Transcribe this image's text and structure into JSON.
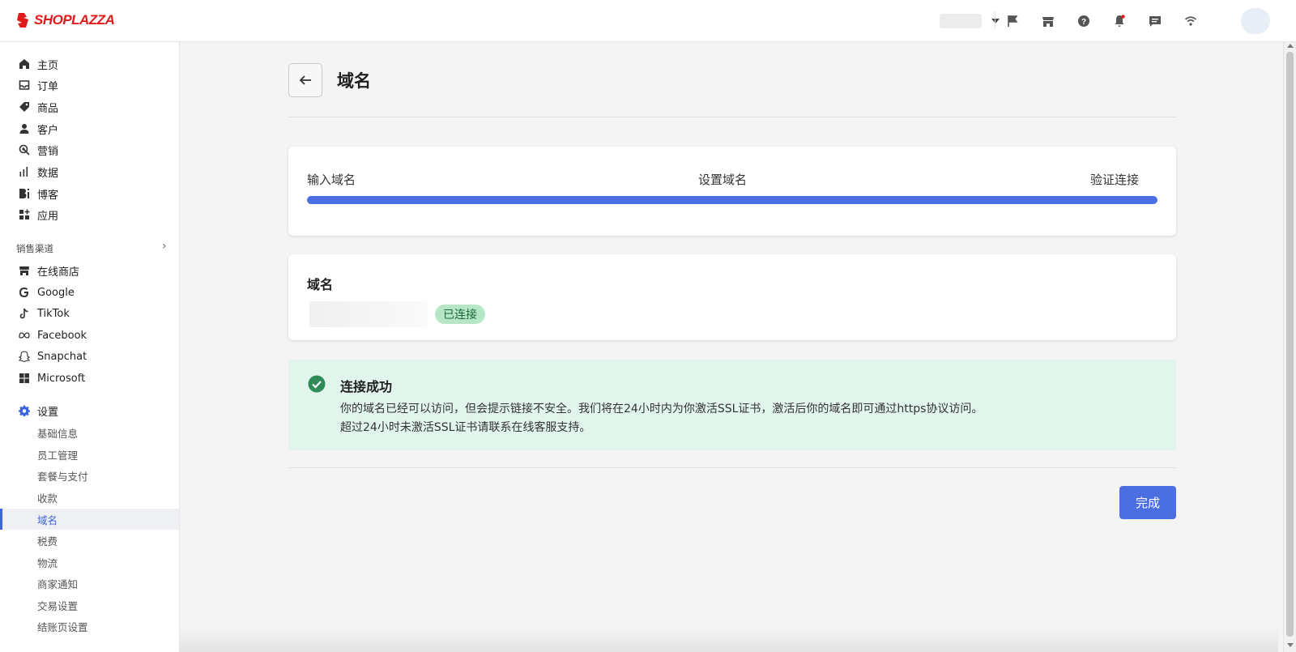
{
  "brand": {
    "logo_text": "SHOPLAZZA",
    "color": "#e01a1a"
  },
  "topbar": {
    "icons": [
      "flag-icon",
      "store-icon",
      "help-icon",
      "bell-icon",
      "message-icon",
      "wifi-icon"
    ]
  },
  "sidebar": {
    "main_items": [
      {
        "label": "主页",
        "icon": "home-icon"
      },
      {
        "label": "订单",
        "icon": "inbox-icon"
      },
      {
        "label": "商品",
        "icon": "tag-icon"
      },
      {
        "label": "客户",
        "icon": "person-icon"
      },
      {
        "label": "营销",
        "icon": "marketing-icon"
      },
      {
        "label": "数据",
        "icon": "bar-chart-icon"
      },
      {
        "label": "博客",
        "icon": "blog-icon"
      },
      {
        "label": "应用",
        "icon": "apps-icon"
      }
    ],
    "sales_channels_title": "销售渠道",
    "channels": [
      {
        "label": "在线商店",
        "icon": "store-icon"
      },
      {
        "label": "Google",
        "icon": "google-icon"
      },
      {
        "label": "TikTok",
        "icon": "tiktok-icon"
      },
      {
        "label": "Facebook",
        "icon": "meta-icon"
      },
      {
        "label": "Snapchat",
        "icon": "snapchat-icon"
      },
      {
        "label": "Microsoft",
        "icon": "microsoft-icon"
      }
    ],
    "settings_label": "设置",
    "settings_items": [
      "基础信息",
      "员工管理",
      "套餐与支付",
      "收款",
      "域名",
      "税费",
      "物流",
      "商家通知",
      "交易设置",
      "结账页设置"
    ],
    "active_item": "域名"
  },
  "page": {
    "title": "域名",
    "steps": [
      "输入域名",
      "设置域名",
      "验证连接"
    ],
    "progress_percent": 100,
    "domain_card": {
      "heading": "域名",
      "status_badge": "已连接"
    },
    "banner": {
      "title": "连接成功",
      "line1": "你的域名已经可以访问，但会提示链接不安全。我们将在24小时内为你激活SSL证书，激活后你的域名即可通过https协议访问。",
      "line2": "超过24小时未激活SSL证书请联系在线客服支持。"
    },
    "done_button": "完成"
  },
  "colors": {
    "accent": "#4b6fe0",
    "success_bg": "#e1f5ec",
    "badge_bg": "#b7e5c7",
    "success_icon": "#2e8b57"
  }
}
